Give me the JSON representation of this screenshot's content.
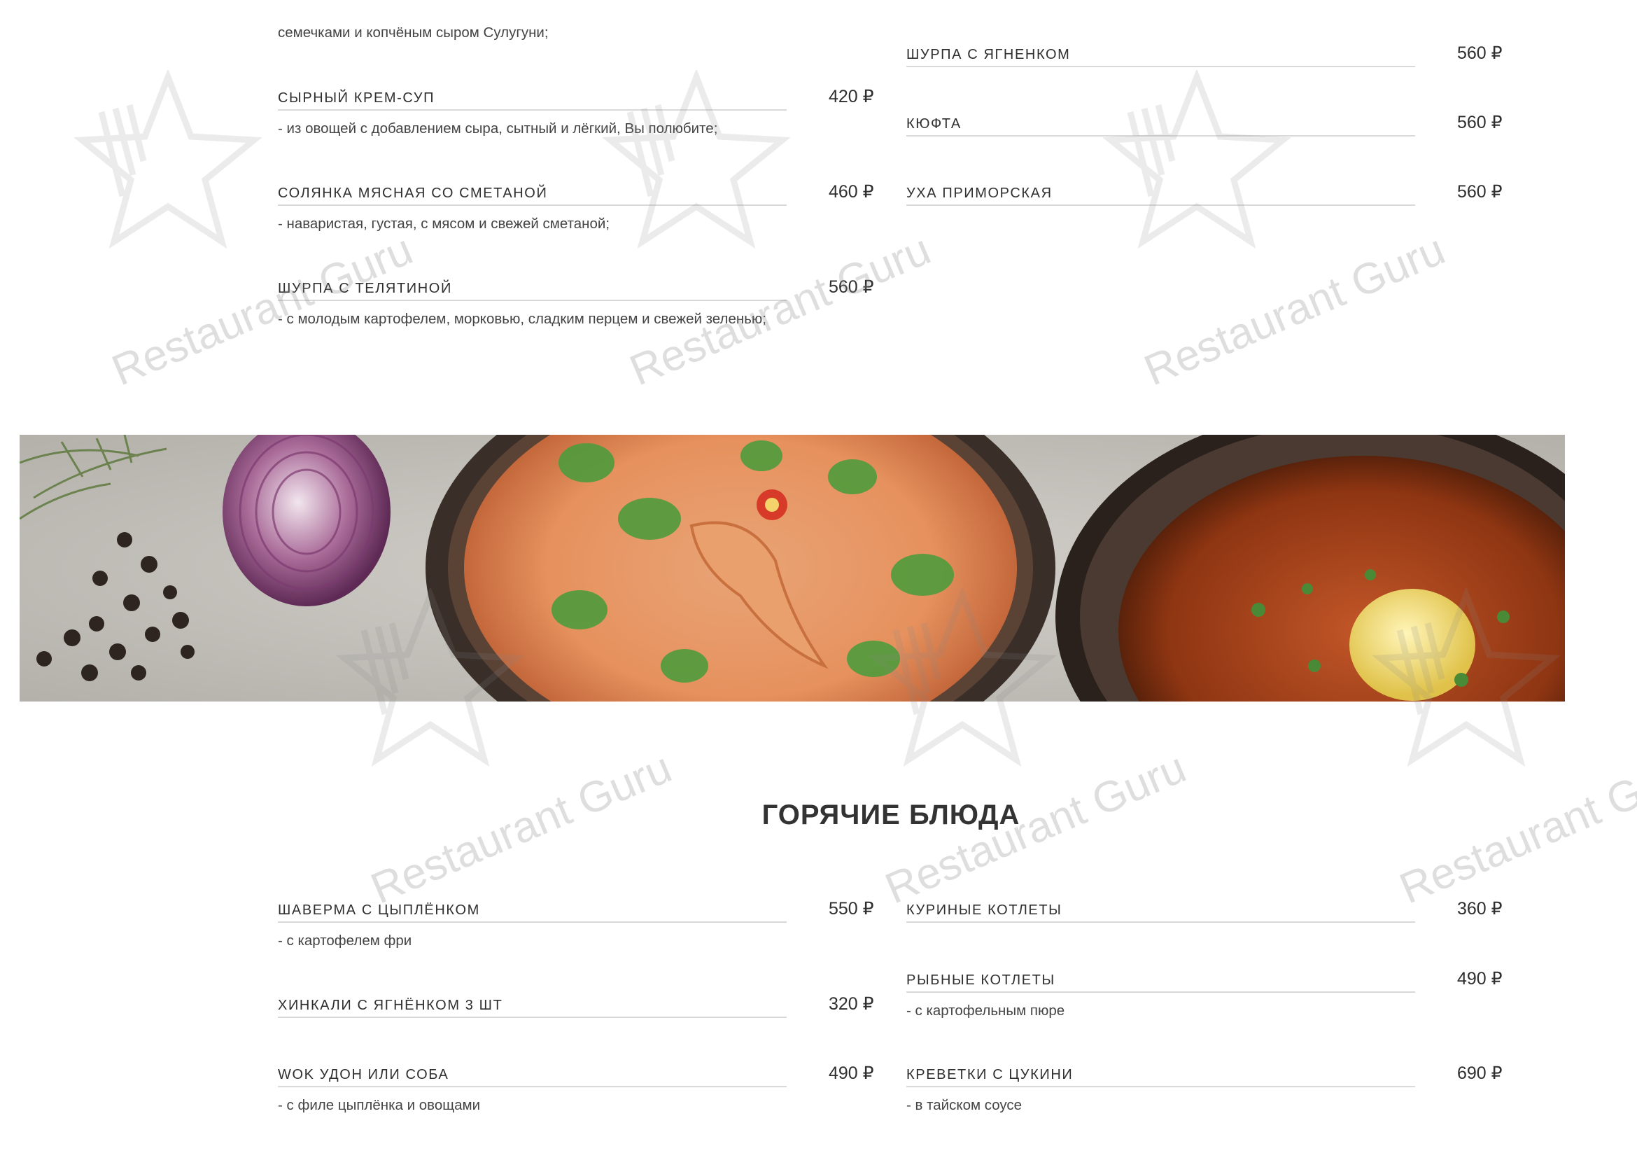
{
  "watermark": {
    "text": "Restaurant Guru",
    "icon": "fork-star-icon"
  },
  "soups": {
    "intro_desc": "семечками и копчёным сыром Сулугуни;",
    "left": [
      {
        "name": "Сырный крем-суп",
        "price": "420 ₽",
        "desc": "- из овощей с добавлением сыра, сытный и лёгкий, Вы полюбите;"
      },
      {
        "name": "Солянка мясная со сметаной",
        "price": "460 ₽",
        "desc": "- наваристая, густая, с мясом и свежей сметаной;"
      },
      {
        "name": "Шурпа с телятиной",
        "price": "560 ₽",
        "desc": "- с молодым картофелем, морковью, сладким перцем и свежей зеленью;"
      }
    ],
    "right": [
      {
        "name": "Шурпа с ягненком",
        "price": "560 ₽"
      },
      {
        "name": "Кюфта",
        "price": "560 ₽"
      },
      {
        "name": "Уха приморская",
        "price": "560 ₽"
      }
    ]
  },
  "banner": {
    "image": "soup-banner-photo"
  },
  "hot": {
    "title": "ГОРЯЧИЕ БЛЮДА",
    "left": [
      {
        "name": "Шаверма с цыплёнком",
        "price": "550 ₽",
        "desc": "- с картофелем фри"
      },
      {
        "name": "Хинкали с ягнёнком 3 шт",
        "price": "320 ₽"
      },
      {
        "name": "Wok удон или соба",
        "price": "490 ₽",
        "desc": "- с филе цыплёнка и овощами"
      }
    ],
    "right": [
      {
        "name": "Куриные котлеты",
        "price": "360 ₽"
      },
      {
        "name": "Рыбные котлеты",
        "price": "490 ₽",
        "desc": "- с картофельным пюре"
      },
      {
        "name": "Креветки с цукини",
        "price": "690 ₽",
        "desc": "- в тайском соусе"
      }
    ]
  }
}
